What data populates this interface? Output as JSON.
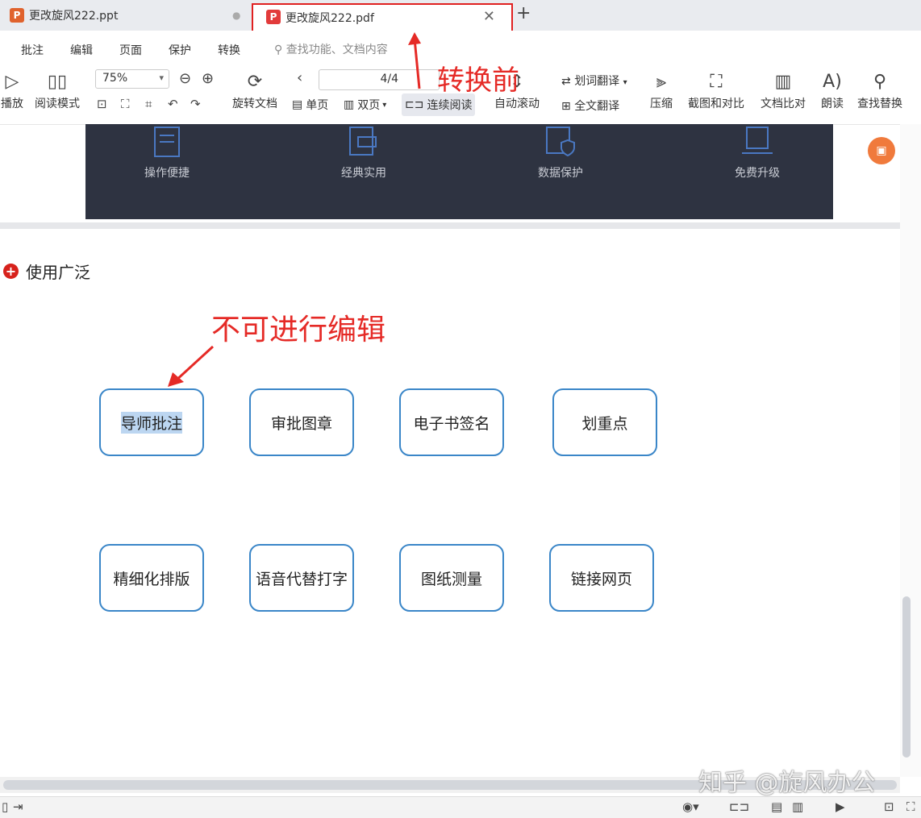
{
  "tabs": {
    "ppt": {
      "icon": "ppt-file-icon",
      "label": "更改旋风222.ppt"
    },
    "pdf": {
      "icon": "pdf-file-icon",
      "label": "更改旋风222.pdf"
    },
    "new_tab": "+"
  },
  "menu": {
    "items": [
      "批注",
      "编辑",
      "页面",
      "保护",
      "转换"
    ],
    "search_placeholder": "查找功能、文档内容"
  },
  "toolbar": {
    "play": "播放",
    "read_mode": "阅读模式",
    "zoom": "75%",
    "rotate": "旋转文档",
    "page": "4/4",
    "single": "单页",
    "double": "双页",
    "continuous": "连续阅读",
    "auto_scroll": "自动滚动",
    "word_translate": "划词翻译",
    "full_translate": "全文翻译",
    "compress": "压缩",
    "screenshot_compare": "截图和对比",
    "doc_compare": "文档比对",
    "read_aloud": "朗读",
    "find_replace": "查找替换"
  },
  "banner": {
    "features": [
      "操作便捷",
      "经典实用",
      "数据保护",
      "免费升级"
    ]
  },
  "section": {
    "title": "使用广泛"
  },
  "cards": {
    "row1": [
      "导师批注",
      "审批图章",
      "电子书签名",
      "划重点"
    ],
    "row2": [
      "精细化排版",
      "语音代替打字",
      "图纸测量",
      "链接网页"
    ]
  },
  "annotations": {
    "before_convert": "转换前",
    "not_editable": "不可进行编辑"
  },
  "watermark": "知乎 @旋风办公",
  "colors": {
    "annotation_red": "#e52a26",
    "card_border": "#3a86c8",
    "banner_bg": "#2e3341",
    "highlight": "#bcd6f1"
  }
}
